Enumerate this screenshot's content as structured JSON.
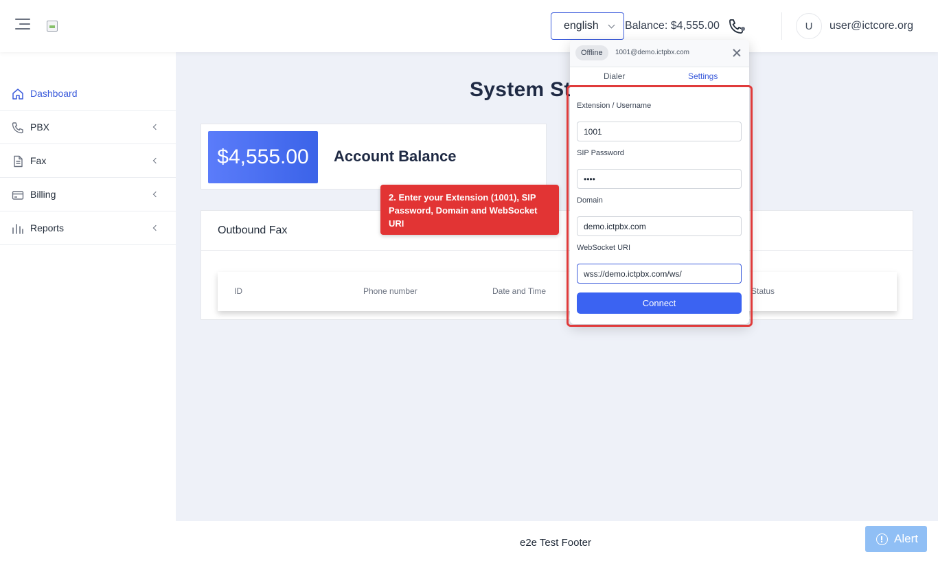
{
  "header": {
    "language": "english",
    "balance": "Balance: $4,555.00",
    "avatar_initial": "U",
    "user_email": "user@ictcore.org"
  },
  "sidebar": {
    "items": [
      {
        "label": "Dashboard",
        "icon": "home-icon",
        "active": true
      },
      {
        "label": "PBX",
        "icon": "phone-icon"
      },
      {
        "label": "Fax",
        "icon": "document-icon"
      },
      {
        "label": "Billing",
        "icon": "credit-card-icon"
      },
      {
        "label": "Reports",
        "icon": "bar-chart-icon"
      }
    ]
  },
  "main": {
    "title": "System St",
    "balance_amount": "$4,555.00",
    "balance_label": "Account Balance",
    "fax_card_title": "Outbound Fax",
    "fax_columns": [
      "ID",
      "Phone number",
      "Date and Time",
      "Status"
    ]
  },
  "tooltip": {
    "text": "2. Enter your Extension (1001), SIP Password, Domain and WebSocket URI"
  },
  "widget": {
    "status": "Offline",
    "account": "1001@demo.ictpbx.com",
    "tabs": [
      "Dialer",
      "Settings"
    ],
    "active_tab": "Settings",
    "fields": {
      "extension_label": "Extension / Username",
      "extension_value": "1001",
      "password_label": "SIP Password",
      "password_value": "••••",
      "domain_label": "Domain",
      "domain_value": "demo.ictpbx.com",
      "ws_label": "WebSocket URI",
      "ws_value": "wss://demo.ictpbx.com/ws/"
    },
    "connect_label": "Connect"
  },
  "footer": {
    "text": "e2e Test Footer",
    "alert_label": "Alert"
  },
  "colors": {
    "accent": "#3b5bdb",
    "tooltip": "#e23434",
    "highlight": "#e03b3b",
    "alert": "#90bff5"
  }
}
